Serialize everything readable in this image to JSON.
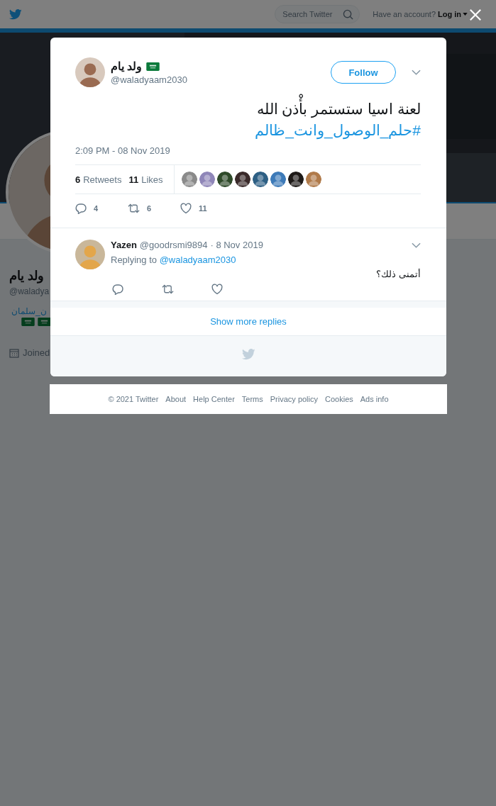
{
  "topbar": {
    "search": {
      "placeholder": "Search Twitter"
    },
    "account_prompt": "Have an account?",
    "login": "Log in"
  },
  "profile": {
    "name": "ولد يام",
    "handle": "@waladya",
    "link": "ن_سلمان",
    "joined": "Joined"
  },
  "tweet": {
    "name": "ولد يام",
    "handle": "@waladyaam2030",
    "follow": "Follow",
    "text": "لعنة اسيا ستستمر بأْذن الله",
    "hashtag": "#حلم_الوصول_وانت_ظالم",
    "timestamp": "2:09 PM - 08 Nov 2019",
    "stats": [
      {
        "count": "6",
        "label": "Retweets"
      },
      {
        "count": "11",
        "label": "Likes"
      }
    ],
    "likers": [
      {
        "color": "#8a8a8a"
      },
      {
        "color": "#8f86b8"
      },
      {
        "color": "#2f4a2a"
      },
      {
        "color": "#3a2a2a"
      },
      {
        "color": "#2d5f84"
      },
      {
        "color": "#3d7ab8"
      },
      {
        "color": "#1e1a18"
      },
      {
        "color": "#b07a4a"
      }
    ],
    "actions": [
      {
        "kind": "reply",
        "count": "4"
      },
      {
        "kind": "retweet",
        "count": "6"
      },
      {
        "kind": "like",
        "count": "11"
      }
    ]
  },
  "replies": [
    {
      "name": "Yazen",
      "handle": "@goodrsmi9894",
      "date": "· 8 Nov 2019",
      "replying_label": "Replying to",
      "replying_to": "@waladyaam2030",
      "text": "أتمنى ذلك؟",
      "actions": [
        {
          "kind": "reply"
        },
        {
          "kind": "retweet"
        },
        {
          "kind": "like"
        }
      ]
    }
  ],
  "show_more": "Show more replies",
  "footer": [
    "© 2021 Twitter",
    "About",
    "Help Center",
    "Terms",
    "Privacy policy",
    "Cookies",
    "Ads info"
  ]
}
